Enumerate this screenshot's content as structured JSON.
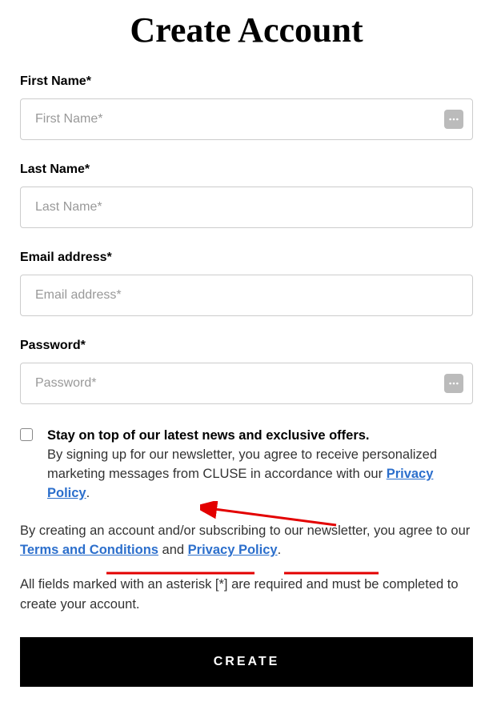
{
  "title": "Create Account",
  "fields": {
    "first_name": {
      "label": "First Name*",
      "placeholder": "First Name*"
    },
    "last_name": {
      "label": "Last Name*",
      "placeholder": "Last Name*"
    },
    "email": {
      "label": "Email address*",
      "placeholder": "Email address*"
    },
    "password": {
      "label": "Password*",
      "placeholder": "Password*"
    }
  },
  "newsletter": {
    "bold_text": "Stay on top of our latest news and exclusive offers.",
    "text_before": "By signing up for our newsletter, you agree to receive personalized marketing messages from CLUSE in accordance with our ",
    "privacy_link": "Privacy Policy",
    "text_after": "."
  },
  "disclaimer": {
    "text_before": "By creating an account and/or subscribing to our newsletter, you agree to our ",
    "terms_link": "Terms and Conditions",
    "text_middle": " and ",
    "privacy_link": "Privacy Policy",
    "text_after": "."
  },
  "required_note": "All fields marked with an asterisk [*] are required and must be completed to create your account.",
  "button": "CREATE"
}
